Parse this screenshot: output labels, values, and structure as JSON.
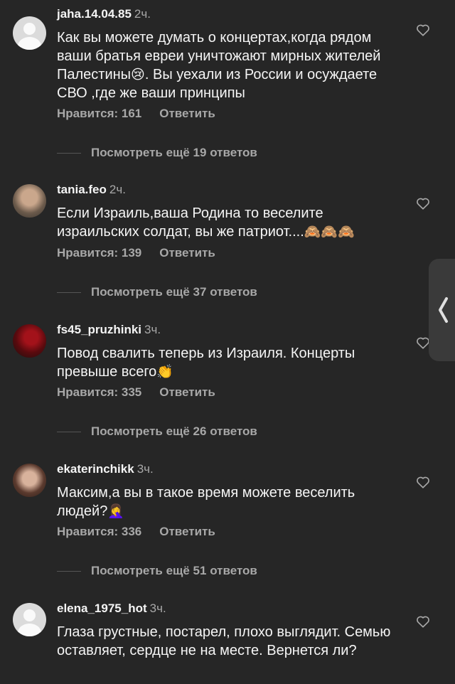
{
  "comments": [
    {
      "username": "jaha.14.04.85",
      "time": "2ч.",
      "text": "Как вы можете думать о концертах,когда рядом ваши братья евреи уничтожают мирных жителей Палестины",
      "emoji": "😢",
      "text_after": ". Вы уехали из России и осуждаете СВО ,где же ваши принципы",
      "likes": "Нравится: 161",
      "reply": "Ответить",
      "more_replies": "Посмотреть ещё 19 ответов",
      "avatar": "default-avatar-icon"
    },
    {
      "username": "tania.feo",
      "time": "2ч.",
      "text": "Если Израиль,ваша Родина то веселите израильских солдат, вы же патриот....",
      "emoji": "🙈🙈🙈",
      "text_after": "",
      "likes": "Нравится: 139",
      "reply": "Ответить",
      "more_replies": "Посмотреть ещё 37 ответов",
      "avatar": "photo"
    },
    {
      "username": "fs45_pruzhinki",
      "time": "3ч.",
      "text": "Повод свалить теперь из Израиля. Концерты превыше всего",
      "emoji": "👏",
      "text_after": "",
      "likes": "Нравится: 335",
      "reply": "Ответить",
      "more_replies": "Посмотреть ещё 26 ответов",
      "avatar": "photo"
    },
    {
      "username": "ekaterinchikk",
      "time": "3ч.",
      "text": "Максим,а вы в такое время можете веселить людей?",
      "emoji": "🤦‍♀️",
      "text_after": "",
      "likes": "Нравится: 336",
      "reply": "Ответить",
      "more_replies": "Посмотреть ещё 51 ответов",
      "avatar": "photo"
    },
    {
      "username": "elena_1975_hot",
      "time": "3ч.",
      "text": "Глаза грустные, постарел, плохо выглядит. Семью оставляет, сердце не на месте. Вернется ли?",
      "emoji": "",
      "text_after": "",
      "avatar": "default-avatar-icon"
    }
  ],
  "icons": {
    "like": "heart-outline-icon",
    "sidetab": "chevron-left-icon"
  },
  "colors": {
    "background": "#262626",
    "text": "#f5f5f5",
    "secondary": "#a8a8a8"
  }
}
